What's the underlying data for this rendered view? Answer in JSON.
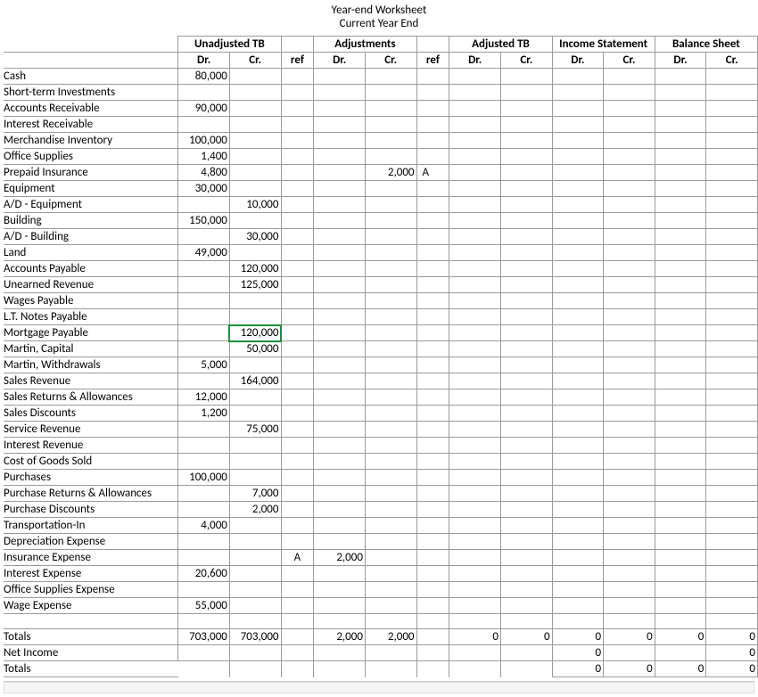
{
  "title1": "Year-end Worksheet",
  "title2": "Current Year End",
  "groups": {
    "unadj": "Unadjusted TB",
    "adj": "Adjustments",
    "adjtb": "Adjusted TB",
    "inc": "Income Statement",
    "bal": "Balance Sheet"
  },
  "sub": {
    "dr": "Dr.",
    "cr": "Cr.",
    "ref": "ref"
  },
  "rows": [
    {
      "label": "Cash",
      "u_dr": "80,000"
    },
    {
      "label": "Short-term Investments"
    },
    {
      "label": "Accounts Receivable",
      "u_dr": "90,000"
    },
    {
      "label": "Interest Receivable"
    },
    {
      "label": "Merchandise Inventory",
      "u_dr": "100,000"
    },
    {
      "label": "Office Supplies",
      "u_dr": "1,400"
    },
    {
      "label": "Prepaid Insurance",
      "u_dr": "4,800",
      "a_cr": "2,000",
      "a_ref2": "A"
    },
    {
      "label": "Equipment",
      "u_dr": "30,000"
    },
    {
      "label": "A/D - Equipment",
      "u_cr": "10,000"
    },
    {
      "label": "Building",
      "u_dr": "150,000"
    },
    {
      "label": "A/D - Building",
      "u_cr": "30,000"
    },
    {
      "label": "Land",
      "u_dr": "49,000"
    },
    {
      "label": "Accounts Payable",
      "u_cr": "120,000"
    },
    {
      "label": "Unearned Revenue",
      "u_cr": "125,000"
    },
    {
      "label": "Wages Payable"
    },
    {
      "label": "L.T. Notes Payable"
    },
    {
      "label": "Mortgage Payable",
      "u_cr": "120,000",
      "sel": true
    },
    {
      "label": "Martin, Capital",
      "u_cr": "50,000"
    },
    {
      "label": "Martin, Withdrawals",
      "u_dr": "5,000"
    },
    {
      "label": "Sales Revenue",
      "u_cr": "164,000"
    },
    {
      "label": "Sales Returns & Allowances",
      "u_dr": "12,000"
    },
    {
      "label": "Sales Discounts",
      "u_dr": "1,200"
    },
    {
      "label": "Service Revenue",
      "u_cr": "75,000"
    },
    {
      "label": "Interest Revenue"
    },
    {
      "label": "Cost of Goods Sold"
    },
    {
      "label": "Purchases",
      "u_dr": "100,000"
    },
    {
      "label": "Purchase Returns & Allowances",
      "u_cr": "7,000"
    },
    {
      "label": "Purchase Discounts",
      "u_cr": "2,000"
    },
    {
      "label": "Transportation-In",
      "u_dr": "4,000"
    },
    {
      "label": "Depreciation Expense"
    },
    {
      "label": "Insurance Expense",
      "a_ref1": "A",
      "a_dr": "2,000"
    },
    {
      "label": "Interest Expense",
      "u_dr": "20,600"
    },
    {
      "label": "Office Supplies Expense"
    },
    {
      "label": "Wage Expense",
      "u_dr": "55,000"
    },
    {
      "label": ""
    }
  ],
  "totals": {
    "label": "Totals",
    "u_dr": "703,000",
    "u_cr": "703,000",
    "a_dr": "2,000",
    "a_cr": "2,000",
    "atb_dr": "0",
    "atb_cr": "0",
    "inc_dr": "0",
    "inc_cr": "0",
    "bal_dr": "0",
    "bal_cr": "0"
  },
  "netincome": {
    "label": "Net Income",
    "inc_dr": "0",
    "bal_cr": "0"
  },
  "totals2": {
    "label": "Totals",
    "inc_dr": "0",
    "inc_cr": "0",
    "bal_dr": "0",
    "bal_cr": "0"
  }
}
